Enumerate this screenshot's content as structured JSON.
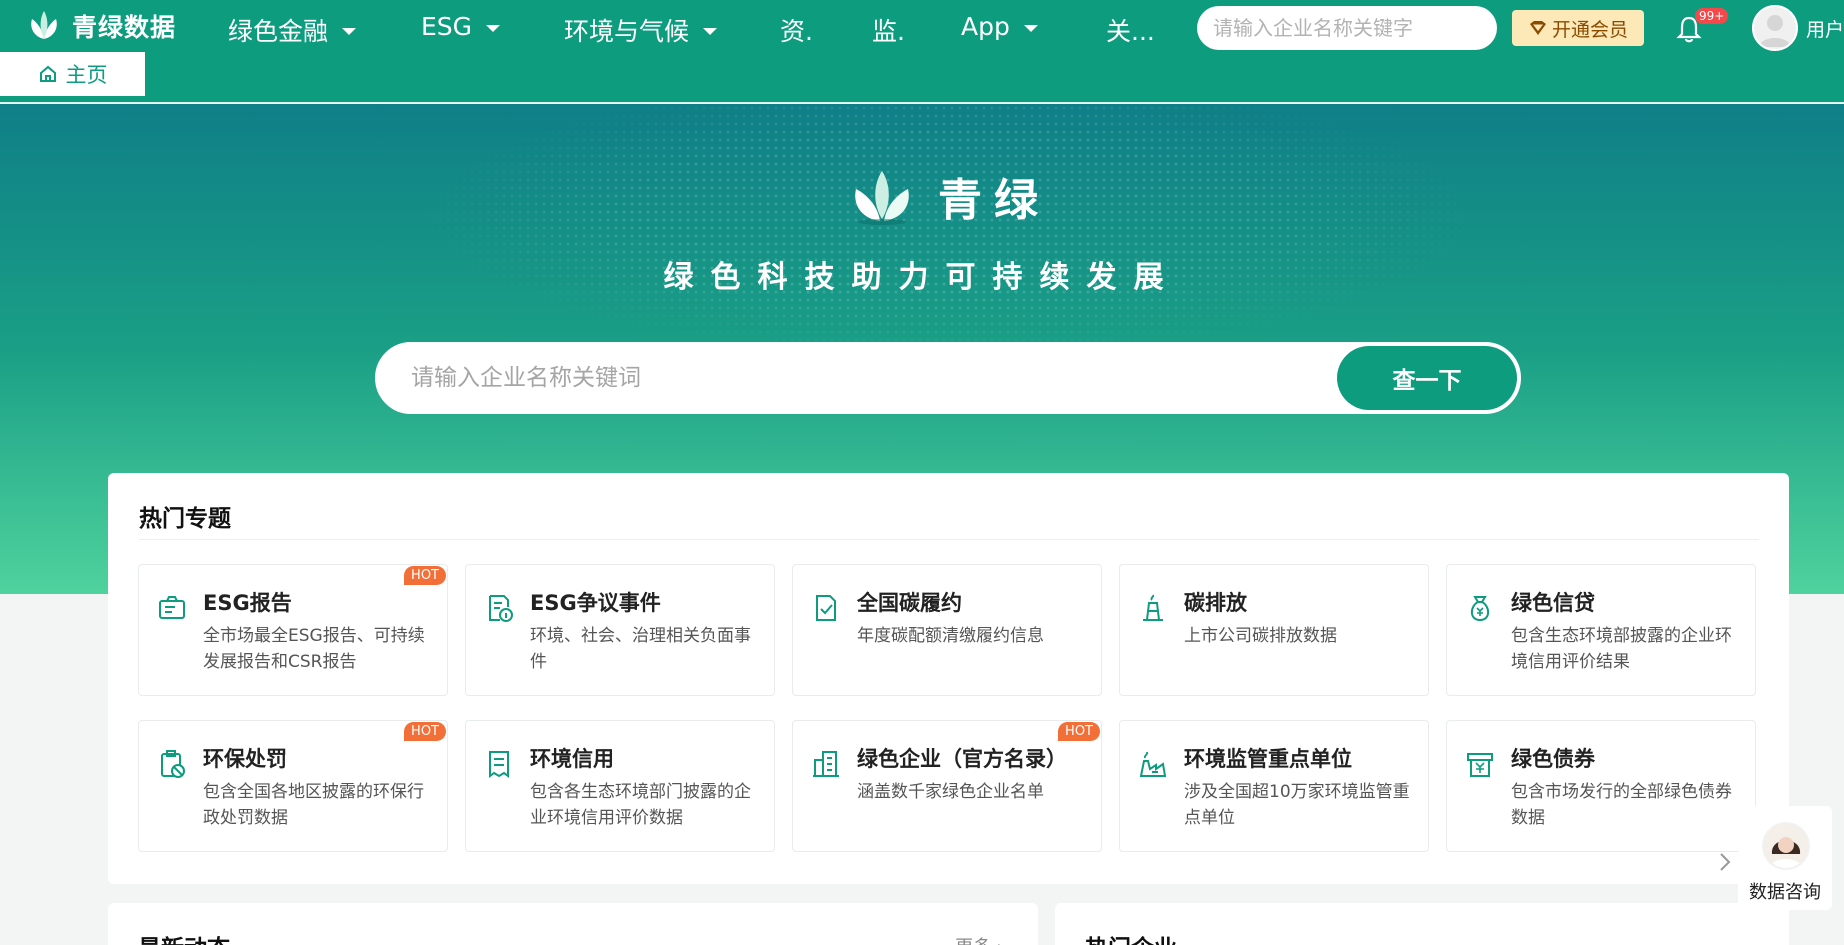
{
  "header": {
    "brand": "青绿数据",
    "nav": [
      {
        "label": "绿色金融"
      },
      {
        "label": "ESG"
      },
      {
        "label": "环境与气候"
      },
      {
        "label": "资."
      },
      {
        "label": "监."
      },
      {
        "label": "App"
      },
      {
        "label": "关..."
      }
    ],
    "search_placeholder": "请输入企业名称关键字",
    "vip_label": "开通会员",
    "notification_count": "99+",
    "user_label": "用户"
  },
  "tabs": {
    "home_label": "主页"
  },
  "hero": {
    "title": "青绿",
    "subtitle": "绿色科技助力可持续发展",
    "search_placeholder": "请输入企业名称关键词",
    "search_button": "查一下"
  },
  "hot_topics": {
    "title": "热门专题",
    "hot_label": "HOT",
    "cards": [
      {
        "title": "ESG报告",
        "desc": "全市场最全ESG报告、可持续发展报告和CSR报告",
        "icon": "report-icon"
      },
      {
        "title": "ESG争议事件",
        "desc": "环境、社会、治理相关负面事件",
        "icon": "controversy-icon"
      },
      {
        "title": "全国碳履约",
        "desc": "年度碳配额清缴履约信息",
        "icon": "compliance-icon"
      },
      {
        "title": "碳排放",
        "desc": "上市公司碳排放数据",
        "icon": "emission-icon"
      },
      {
        "title": "绿色信贷",
        "desc": "包含生态环境部披露的企业环境信用评价结果",
        "icon": "credit-bag-icon"
      },
      {
        "title": "环保处罚",
        "desc": "包含全国各地区披露的环保行政处罚数据",
        "icon": "penalty-icon"
      },
      {
        "title": "环境信用",
        "desc": "包含各生态环境部门披露的企业环境信用评价数据",
        "icon": "credit-doc-icon"
      },
      {
        "title": "绿色企业（官方名录）",
        "desc": "涵盖数千家绿色企业名单",
        "icon": "building-icon"
      },
      {
        "title": "环境监管重点单位",
        "desc": "涉及全国超10万家环境监管重点单位",
        "icon": "factory-icon"
      },
      {
        "title": "绿色债券",
        "desc": "包含市场发行的全部绿色债券数据",
        "icon": "bond-icon"
      }
    ]
  },
  "latest_news": {
    "title": "最新动态",
    "more": "更多 ›"
  },
  "hot_companies": {
    "title": "热门企业"
  },
  "consult": {
    "label": "数据咨询"
  },
  "colors": {
    "brand_green": "#0e9c7f",
    "hot_orange": "#f36f38",
    "vip_gold": "#fce9b7"
  }
}
